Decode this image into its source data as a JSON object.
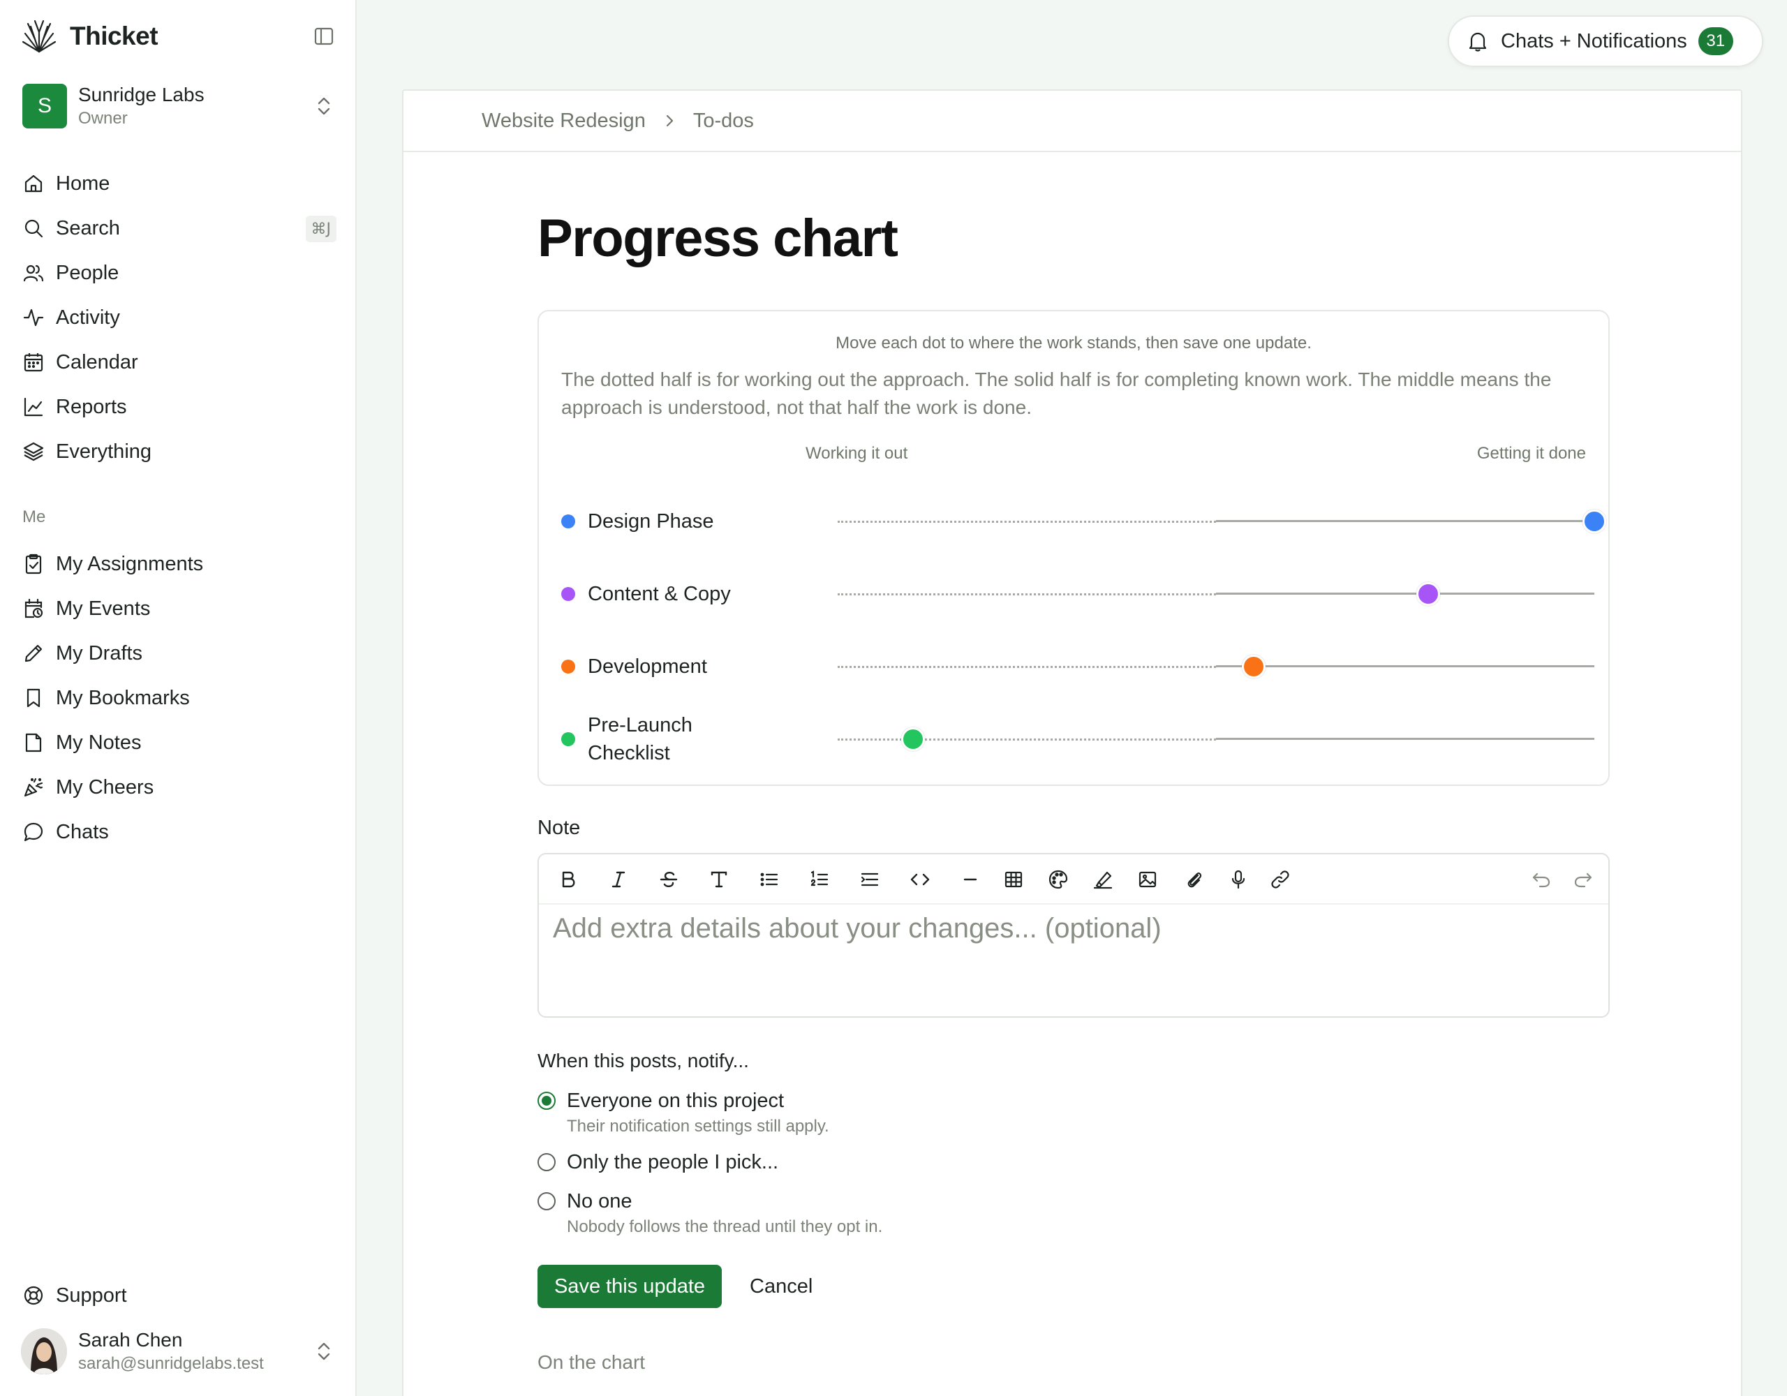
{
  "brand": {
    "name": "Thicket"
  },
  "account": {
    "initial": "S",
    "name": "Sunridge Labs",
    "role": "Owner"
  },
  "nav": {
    "items": [
      {
        "label": "Home",
        "icon": "home-icon"
      },
      {
        "label": "Search",
        "icon": "search-icon",
        "shortcut": "⌘J"
      },
      {
        "label": "People",
        "icon": "people-icon"
      },
      {
        "label": "Activity",
        "icon": "activity-icon"
      },
      {
        "label": "Calendar",
        "icon": "calendar-icon"
      },
      {
        "label": "Reports",
        "icon": "reports-icon"
      },
      {
        "label": "Everything",
        "icon": "layers-icon"
      }
    ],
    "me_label": "Me",
    "me_items": [
      {
        "label": "My Assignments",
        "icon": "clipboard-check-icon"
      },
      {
        "label": "My Events",
        "icon": "calendar-clock-icon"
      },
      {
        "label": "My Drafts",
        "icon": "pencil-icon"
      },
      {
        "label": "My Bookmarks",
        "icon": "bookmark-icon"
      },
      {
        "label": "My Notes",
        "icon": "note-icon"
      },
      {
        "label": "My Cheers",
        "icon": "party-popper-icon"
      },
      {
        "label": "Chats",
        "icon": "chat-bubble-icon"
      }
    ],
    "support": "Support"
  },
  "user": {
    "name": "Sarah Chen",
    "email": "sarah@sunridgelabs.test"
  },
  "notifications": {
    "label": "Chats + Notifications",
    "count": "31"
  },
  "breadcrumb": [
    "Website Redesign",
    "To-dos"
  ],
  "page_title": "Progress chart",
  "chart": {
    "instruction": "Move each dot to where the work stands, then save one update.",
    "description": "The dotted half is for working out the approach. The solid half is for completing known work. The middle means the approach is understood, not that half the work is done.",
    "axis_left": "Working it out",
    "axis_right": "Getting it done"
  },
  "chart_data": {
    "type": "scatter",
    "x_range": [
      0,
      100
    ],
    "series": [
      {
        "name": "Design Phase",
        "value": 100,
        "color": "#3b82f6"
      },
      {
        "name": "Content & Copy",
        "value": 78,
        "color": "#a855f7"
      },
      {
        "name": "Development",
        "value": 55,
        "color": "#f97316"
      },
      {
        "name": "Pre-Launch Checklist",
        "value": 10,
        "color": "#22c55e"
      }
    ]
  },
  "note": {
    "label": "Note",
    "placeholder": "Add extra details about your changes... (optional)"
  },
  "notify": {
    "label": "When this posts, notify...",
    "options": [
      {
        "title": "Everyone on this project",
        "sub": "Their notification settings still apply.",
        "checked": true
      },
      {
        "title": "Only the people I pick...",
        "sub": "",
        "checked": false
      },
      {
        "title": "No one",
        "sub": "Nobody follows the thread until they opt in.",
        "checked": false
      }
    ]
  },
  "actions": {
    "save": "Save this update",
    "cancel": "Cancel"
  },
  "footer_heading": "On the chart",
  "colors": {
    "accent": "#1b7a36",
    "brand_avatar": "#1b8a3c"
  }
}
